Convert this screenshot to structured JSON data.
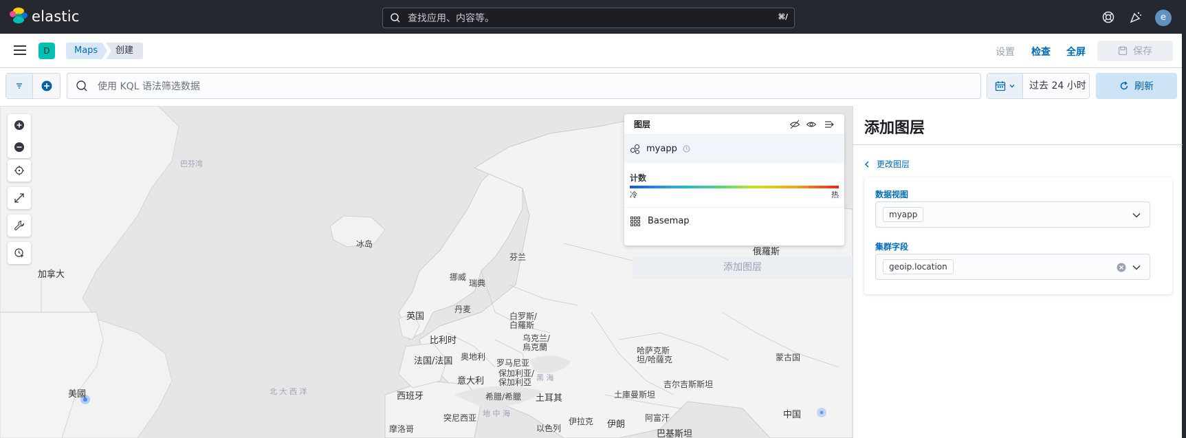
{
  "header": {
    "app_name": "elastic",
    "search_placeholder": "查找应用、内容等。",
    "search_shortcut": "⌘/",
    "avatar_initial": "e"
  },
  "subbar": {
    "space_initial": "D",
    "breadcrumbs": [
      "Maps",
      "创建"
    ],
    "actions": {
      "settings": "设置",
      "inspect": "检查",
      "fullscreen": "全屏",
      "save": "保存"
    }
  },
  "querybar": {
    "kql_placeholder": "使用 KQL 语法筛选数据",
    "date_range": "过去 24 小时",
    "refresh_label": "刷新"
  },
  "map": {
    "labels": {
      "greenland_sea": "巴芬湾",
      "canada": "加拿大",
      "iceland": "冰岛",
      "finland": "芬兰",
      "norway": "挪威",
      "sweden": "瑞典",
      "denmark": "丹麦",
      "uk": "英国",
      "belarus": "白罗斯/\n白羅斯",
      "ukraine": "乌克兰/\n烏克蘭",
      "belgium": "比利时",
      "france": "法国/法国",
      "austria": "奥地利",
      "romania": "罗马尼亚",
      "bulgaria": "保加利亚/\n保加利亞",
      "black_sea": "黑 海",
      "italy": "意大利",
      "greece": "希腊/希臘",
      "turkey": "土耳其",
      "spain": "西班牙",
      "mediterranean": "地 中 海",
      "tunisia": "突尼西亚",
      "morocco": "摩洛哥",
      "atlantic": "北 大 西 洋",
      "usa": "美國",
      "russia": "俄羅斯",
      "kazakhstan": "哈萨克斯\n坦/哈薩克",
      "mongolia": "蒙古国",
      "turkmenistan": "土庫曼斯坦",
      "kyrgyzstan": "吉尔吉斯斯坦",
      "afghanistan": "阿富汗",
      "pakistan": "巴基斯坦",
      "iran": "伊朗",
      "iraq": "伊拉克",
      "israel": "以色列",
      "china": "中国"
    },
    "layer_panel": {
      "title": "图层",
      "layers": [
        {
          "name": "myapp"
        },
        {
          "name": "Basemap"
        }
      ],
      "legend": {
        "title": "计数",
        "low": "冷",
        "high": "热"
      }
    },
    "add_layer_ghost": "添加图层"
  },
  "flyout": {
    "title": "添加图层",
    "back_label": "更改图层",
    "data_view_label": "数据视图",
    "data_view_value": "myapp",
    "cluster_field_label": "集群字段",
    "cluster_field_value": "geoip.location"
  },
  "colors": {
    "header_bg": "#25282f",
    "accent": "#006bb8",
    "space_badge": "#00bfb3",
    "refresh_bg": "#cce4f5"
  }
}
